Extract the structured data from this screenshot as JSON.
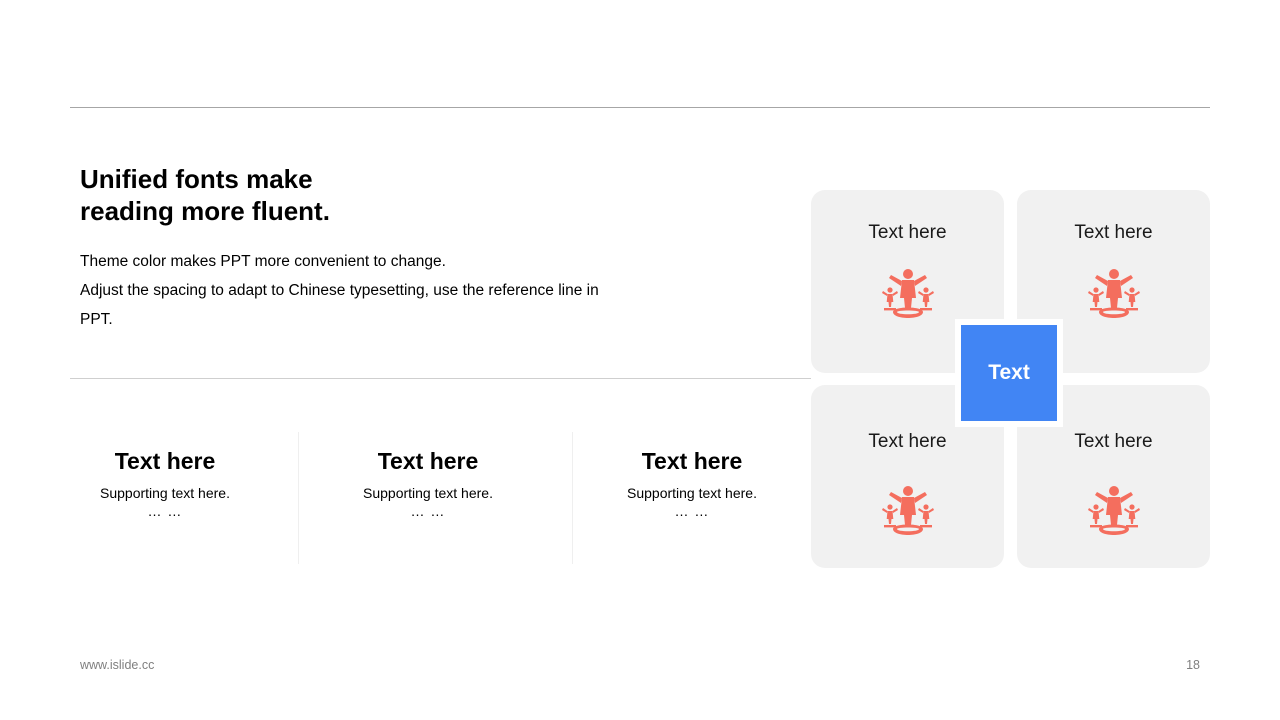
{
  "headline": "Unified fonts make reading more fluent.",
  "body": {
    "line1": "Theme color makes PPT more convenient to change.",
    "line2": "Adjust the spacing to adapt to Chinese typesetting, use the reference line in PPT."
  },
  "features": [
    {
      "title": "Text here",
      "sub": "Supporting  text here.",
      "dots": "… …"
    },
    {
      "title": "Text here",
      "sub": "Supporting  text here.",
      "dots": "… …"
    },
    {
      "title": "Text here",
      "sub": "Supporting  text here.",
      "dots": "… …"
    }
  ],
  "cards": [
    {
      "label": "Text here",
      "icon": "balance-figure-icon"
    },
    {
      "label": "Text here",
      "icon": "balance-figure-icon"
    },
    {
      "label": "Text here",
      "icon": "balance-figure-icon"
    },
    {
      "label": "Text here",
      "icon": "balance-figure-icon"
    }
  ],
  "center_label": "Text",
  "footer": {
    "url": "www.islide.cc",
    "page": "18"
  },
  "colors": {
    "accent": "#4185f4",
    "icon": "#f46e5e",
    "card_bg": "#f1f1f1"
  }
}
